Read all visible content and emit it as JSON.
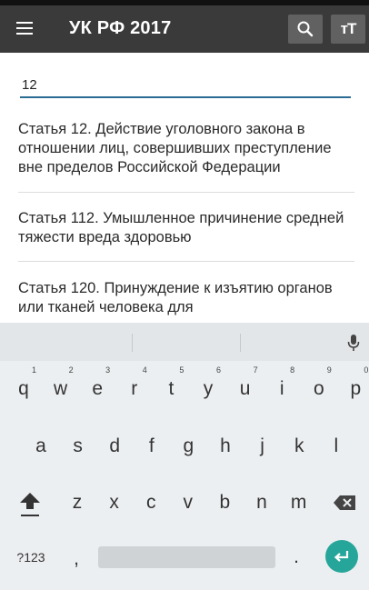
{
  "appbar": {
    "title": "УК РФ 2017",
    "menu_icon": "hamburger-menu-icon",
    "search_icon": "search-icon",
    "text_size_icon": "text-size-icon",
    "text_size_label": "тТ",
    "background": "#3a3a3a"
  },
  "search": {
    "value": "12",
    "accent": "#2b6c94"
  },
  "results": [
    {
      "text": "Статья 12. Действие уголовного закона в отношении лиц, совершивших преступление вне пределов Российской Федерации"
    },
    {
      "text": "Статья 112. Умышленное причинение средней тяжести вреда здоровью"
    },
    {
      "text": "Статья 120. Принуждение к изъятию органов или тканей человека для"
    }
  ],
  "keyboard": {
    "row1": [
      "q",
      "w",
      "e",
      "r",
      "t",
      "y",
      "u",
      "i",
      "o",
      "p"
    ],
    "row1_hints": [
      "1",
      "2",
      "3",
      "4",
      "5",
      "6",
      "7",
      "8",
      "9",
      "0"
    ],
    "row2": [
      "a",
      "s",
      "d",
      "f",
      "g",
      "h",
      "j",
      "k",
      "l"
    ],
    "row3": [
      "z",
      "x",
      "c",
      "v",
      "b",
      "n",
      "m"
    ],
    "symbols_label": "?123",
    "comma": ",",
    "period": ".",
    "shift_icon": "shift-icon",
    "backspace_icon": "backspace-icon",
    "mic_icon": "microphone-icon",
    "enter_icon": "enter-icon",
    "enter_color": "#26a69a"
  }
}
